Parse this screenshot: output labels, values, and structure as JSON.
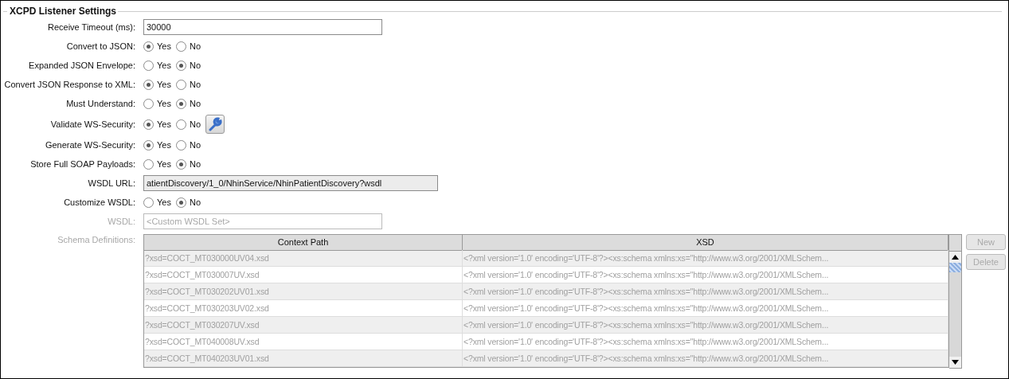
{
  "section": {
    "title": "XCPD Listener Settings"
  },
  "fields": [
    {
      "kind": "text",
      "label": "Receive Timeout (ms):",
      "value": "30000",
      "readonly": false,
      "disabled": false
    },
    {
      "kind": "radio",
      "label": "Convert to JSON:",
      "settings_button": false,
      "options": [
        {
          "label": "Yes",
          "selected": true
        },
        {
          "label": "No",
          "selected": false
        }
      ]
    },
    {
      "kind": "radio",
      "label": "Expanded JSON Envelope:",
      "settings_button": false,
      "options": [
        {
          "label": "Yes",
          "selected": false
        },
        {
          "label": "No",
          "selected": true
        }
      ]
    },
    {
      "kind": "radio",
      "label": "Convert JSON Response to XML:",
      "settings_button": false,
      "options": [
        {
          "label": "Yes",
          "selected": true
        },
        {
          "label": "No",
          "selected": false
        }
      ]
    },
    {
      "kind": "radio",
      "label": "Must Understand:",
      "settings_button": false,
      "options": [
        {
          "label": "Yes",
          "selected": false
        },
        {
          "label": "No",
          "selected": true
        }
      ]
    },
    {
      "kind": "radio",
      "label": "Validate WS-Security:",
      "settings_button": true,
      "options": [
        {
          "label": "Yes",
          "selected": true
        },
        {
          "label": "No",
          "selected": false
        }
      ]
    },
    {
      "kind": "radio",
      "label": "Generate WS-Security:",
      "settings_button": false,
      "options": [
        {
          "label": "Yes",
          "selected": true
        },
        {
          "label": "No",
          "selected": false
        }
      ]
    },
    {
      "kind": "radio",
      "label": "Store Full SOAP Payloads:",
      "settings_button": false,
      "options": [
        {
          "label": "Yes",
          "selected": false
        },
        {
          "label": "No",
          "selected": true
        }
      ]
    },
    {
      "kind": "text",
      "label": "WSDL URL:",
      "value": "atientDiscovery/1_0/NhinService/NhinPatientDiscovery?wsdl",
      "readonly": true,
      "disabled": false
    },
    {
      "kind": "radio",
      "label": "Customize WSDL:",
      "settings_button": false,
      "options": [
        {
          "label": "Yes",
          "selected": false
        },
        {
          "label": "No",
          "selected": true
        }
      ]
    },
    {
      "kind": "text",
      "label": "WSDL:",
      "placeholder": "<Custom WSDL Set>",
      "readonly": false,
      "disabled": true
    },
    {
      "kind": "table",
      "label": "Schema Definitions:",
      "disabled": true,
      "columns": [
        "Context Path",
        "XSD"
      ],
      "rows": [
        {
          "context_path": "?xsd=COCT_MT030000UV04.xsd",
          "xsd": "<?xml version='1.0' encoding='UTF-8'?><xs:schema xmlns:xs=\"http://www.w3.org/2001/XMLSchem..."
        },
        {
          "context_path": "?xsd=COCT_MT030007UV.xsd",
          "xsd": "<?xml version='1.0' encoding='UTF-8'?><xs:schema xmlns:xs=\"http://www.w3.org/2001/XMLSchem..."
        },
        {
          "context_path": "?xsd=COCT_MT030202UV01.xsd",
          "xsd": "<?xml version='1.0' encoding='UTF-8'?><xs:schema xmlns:xs=\"http://www.w3.org/2001/XMLSchem..."
        },
        {
          "context_path": "?xsd=COCT_MT030203UV02.xsd",
          "xsd": "<?xml version='1.0' encoding='UTF-8'?><xs:schema xmlns:xs=\"http://www.w3.org/2001/XMLSchem..."
        },
        {
          "context_path": "?xsd=COCT_MT030207UV.xsd",
          "xsd": "<?xml version='1.0' encoding='UTF-8'?><xs:schema xmlns:xs=\"http://www.w3.org/2001/XMLSchem..."
        },
        {
          "context_path": "?xsd=COCT_MT040008UV.xsd",
          "xsd": "<?xml version='1.0' encoding='UTF-8'?><xs:schema xmlns:xs=\"http://www.w3.org/2001/XMLSchem..."
        },
        {
          "context_path": "?xsd=COCT_MT040203UV01.xsd",
          "xsd": "<?xml version='1.0' encoding='UTF-8'?><xs:schema xmlns:xs=\"http://www.w3.org/2001/XMLSchem..."
        }
      ],
      "buttons": [
        {
          "label": "New",
          "disabled": true
        },
        {
          "label": "Delete",
          "disabled": true
        }
      ]
    }
  ]
}
